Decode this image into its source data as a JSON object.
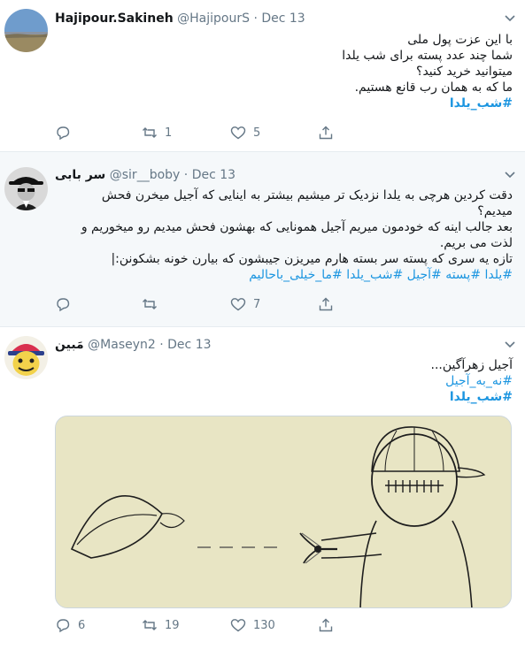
{
  "colors": {
    "accent": "#1b95e0",
    "muted": "#657786",
    "text": "#14171a",
    "separator": "#e6ecf0"
  },
  "tweets": [
    {
      "name": "Hajipour.Sakineh",
      "handle": "@HajipourS",
      "separator": "·",
      "date": "Dec 13",
      "lines": [
        "با این عزت پول ملی",
        "شما چند عدد پسته برای شب یلدا",
        "میتوانید خرید کنید؟",
        "ما که به همان رب قانع هستیم."
      ],
      "hashtags": "#شب_یلدا",
      "counts": {
        "reply": "",
        "retweet": "1",
        "like": "5"
      },
      "avatar_icon": "landscape-avatar"
    },
    {
      "name": "سر بابی",
      "handle": "@sir__boby",
      "separator": "·",
      "date": "Dec 13",
      "lines": [
        "دقت کردین هرچی به یلدا نزدیک تر میشیم بیشتر به اینایی که آجیل میخرن فحش",
        "میدیم؟",
        "بعد جالب اینه که خودمون میریم آجیل همونایی که بهشون فحش میدیم رو میخوریم و",
        "لذت می بریم.",
        "تازه یه سری که پسته سر بسته هارم میریزن جیبشون که بیارن خونه بشکونن:|"
      ],
      "hashtags": "#یلدا #پسته #آجیل #شب_یلدا #ما_خیلی_باحالیم",
      "counts": {
        "reply": "",
        "retweet": "",
        "like": "7"
      },
      "avatar_icon": "man-in-hat-avatar"
    },
    {
      "name": "مَبین",
      "handle": "@Maseyn2",
      "separator": "·",
      "date": "Dec 13",
      "lines": [
        "آجیل زهرآگین..."
      ],
      "hashtags_lines": [
        "#نه_به_آجیل",
        "#شب_یلدا"
      ],
      "counts": {
        "reply": "6",
        "retweet": "19",
        "like": "130"
      },
      "avatar_icon": "cartoon-face-avatar",
      "media_icon": "drawing-slingshot-pistachio"
    }
  ]
}
